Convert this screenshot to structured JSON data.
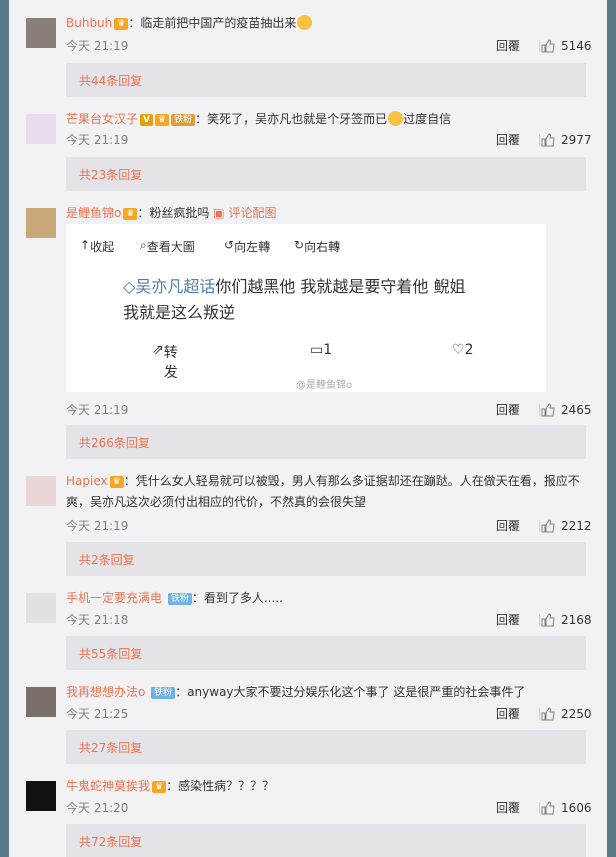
{
  "reply_label": "回覆",
  "comments": [
    {
      "name": "Buhbuh",
      "text": "：临走前把中国产的疫苗抽出来",
      "time": "今天 21:19",
      "likes": "5146",
      "replies": "共44条回复"
    },
    {
      "name": "芒果台女汉子",
      "badge_v": "V",
      "badge_fans": "铁粉",
      "text": "：笑死了，吴亦凡也就是个牙签而已",
      "text_after": "过度自信",
      "time": "今天 21:19",
      "likes": "2977",
      "replies": "共23条回复"
    },
    {
      "name": "是鲤鱼锦o",
      "text": "：粉丝疯批吗",
      "pic_link": "评论配图",
      "time": "今天 21:19",
      "likes": "2465",
      "replies": "共266条回复",
      "pic": {
        "collapse": "收起",
        "view_large": "查看大圖",
        "rotate_left": "向左轉",
        "rotate_right": "向右轉",
        "topic": "吴亦凡超话",
        "line1": "你们越黑他 我就越是要守着他 鲵姐",
        "line2": "我就是这么叛逆",
        "repost": "转发",
        "comments": "1",
        "likes": "2",
        "watermark": "@是鲤鱼锦o"
      }
    },
    {
      "name": "Hapiex",
      "text": "：凭什么女人轻易就可以被毁，男人有那么多证据却还在蹦跶。人在做天在看，报应不",
      "text2": "爽，吴亦凡这次必须付出相应的代价，不然真的会很失望",
      "time": "今天 21:19",
      "likes": "2212",
      "replies": "共2条回复"
    },
    {
      "name": "手机一定要充满电",
      "badge_tie": "铁粉",
      "text": "：看到了多人.....",
      "time": "今天 21:18",
      "likes": "2168",
      "replies": "共55条回复"
    },
    {
      "name": "我再想想办法o",
      "badge_tie": "铁粉",
      "text": "：anyway大家不要过分娱乐化这个事了 这是很严重的社会事件了",
      "time": "今天 21:25",
      "likes": "2250",
      "replies": "共27条回复"
    },
    {
      "name": "牛鬼蛇神莫挨我",
      "text": "：感染性病？？？？",
      "time": "今天 21:20",
      "likes": "1606",
      "replies": "共72条回复"
    }
  ]
}
